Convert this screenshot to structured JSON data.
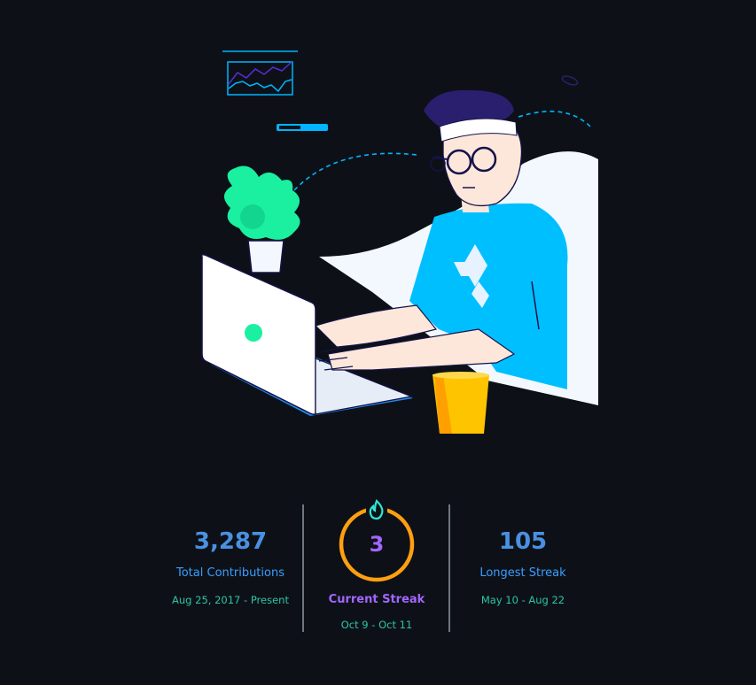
{
  "stats": {
    "total": {
      "value": "3,287",
      "label": "Total Contributions",
      "range": "Aug 25, 2017 - Present"
    },
    "current": {
      "value": "3",
      "label": "Current Streak",
      "range": "Oct 9 - Oct 11"
    },
    "longest": {
      "value": "105",
      "label": "Longest Streak",
      "range": "May 10 - Aug 22"
    }
  },
  "colors": {
    "background": "#0d1117",
    "number_blue": "#4a90e2",
    "label_blue": "#3b9dff",
    "range_teal": "#2ec4a6",
    "ring_orange": "#ff9f10",
    "flame_teal": "#2ee6d6",
    "purple": "#a366ff",
    "divider": "#6e7681"
  },
  "icons": [
    "fire-icon"
  ]
}
